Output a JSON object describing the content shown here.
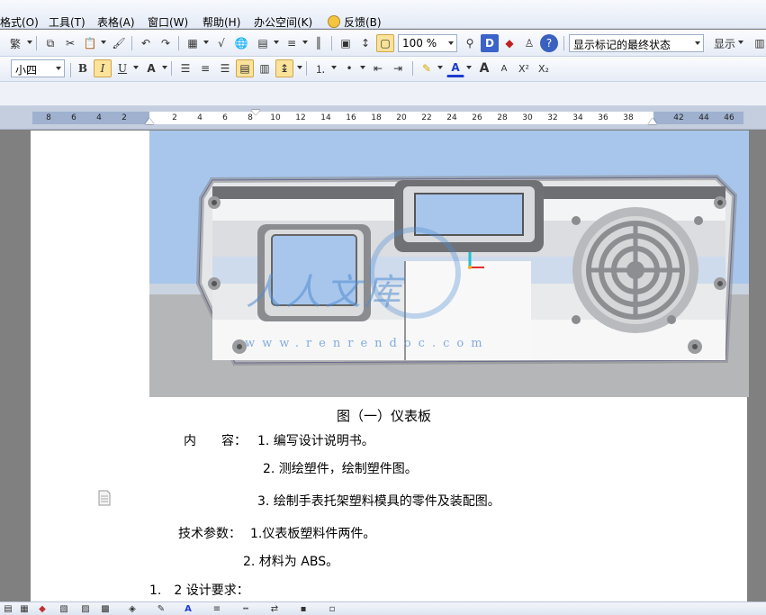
{
  "menubar": {
    "items": [
      {
        "label": "格式(O)"
      },
      {
        "label": "工具(T)"
      },
      {
        "label": "表格(A)"
      },
      {
        "label": "窗口(W)"
      },
      {
        "label": "帮助(H)"
      },
      {
        "label": "办公空间(K)"
      },
      {
        "label": "反馈(B)"
      }
    ]
  },
  "toolbar1": {
    "traditional": "繁",
    "zoom": "100 %",
    "track_changes_view": "显示标记的最终状态",
    "show_label": "显示"
  },
  "toolbar2": {
    "font_size": "小四",
    "bold": "B",
    "italic": "I",
    "underline": "U",
    "char_scale": "A",
    "font_color": "A",
    "grow_font": "A",
    "shrink_font": "A",
    "superscript": "X²",
    "subscript": "X₂"
  },
  "ruler": {
    "ticks": [
      "8",
      "6",
      "4",
      "2",
      "2",
      "4",
      "6",
      "8",
      "10",
      "12",
      "14",
      "16",
      "18",
      "20",
      "22",
      "24",
      "26",
      "28",
      "30",
      "32",
      "34",
      "36",
      "38",
      "42",
      "44",
      "46"
    ]
  },
  "figure": {
    "watermark": "人人文库",
    "watermark_url": "www.renrendoc.com",
    "colors": {
      "sky": "#a8c6ec",
      "panel": "#d9dcdf",
      "floor": "#b4b6b8"
    }
  },
  "document": {
    "caption": "图（一）仪表板",
    "content_label": "内　　容：",
    "content_1": "1. 编写设计说明书。",
    "content_2": "2. 测绘塑件，绘制塑件图。",
    "content_3": "3. 绘制手表托架塑料模具的零件及装配图。",
    "tech_label": "技术参数：",
    "tech_1": "1.仪表板塑料件两件。",
    "tech_2": "2. 材料为 ABS。",
    "section": "1.　2 设计要求："
  }
}
